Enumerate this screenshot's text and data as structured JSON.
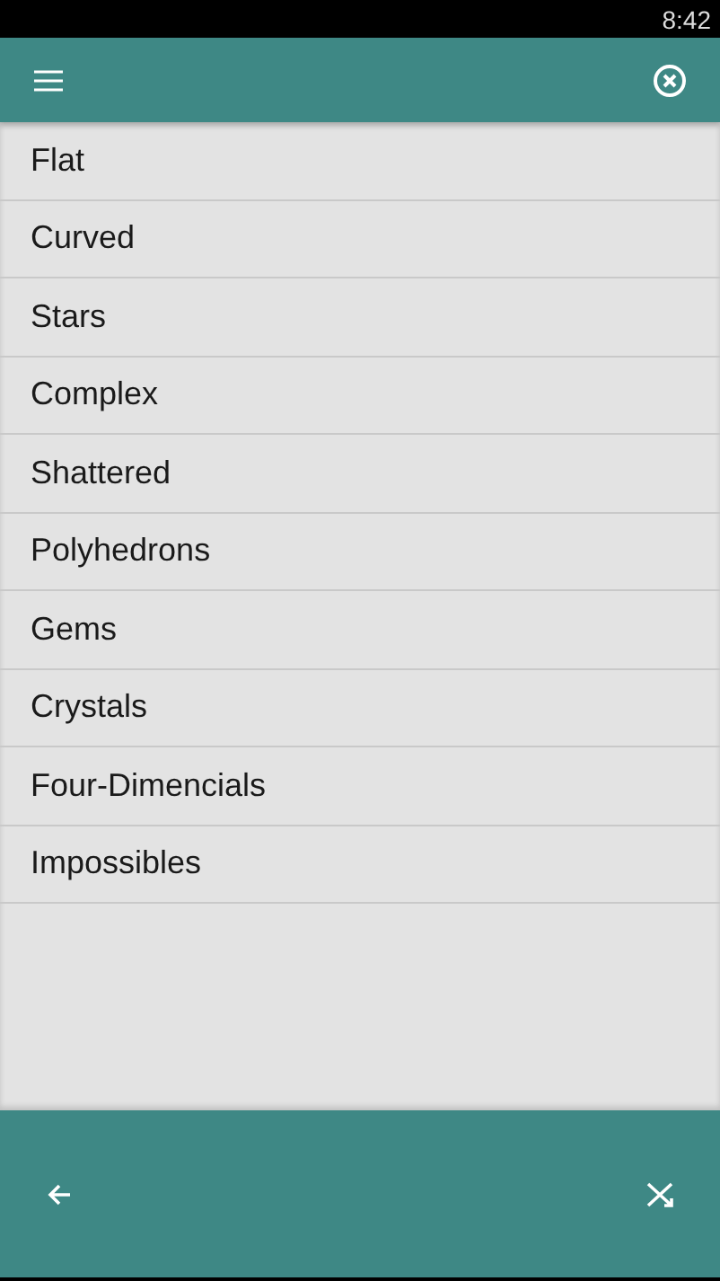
{
  "status_bar": {
    "time": "8:42"
  },
  "list": {
    "items": [
      {
        "label": "Flat"
      },
      {
        "label": "Curved"
      },
      {
        "label": "Stars"
      },
      {
        "label": "Complex"
      },
      {
        "label": "Shattered"
      },
      {
        "label": "Polyhedrons"
      },
      {
        "label": "Gems"
      },
      {
        "label": "Crystals"
      },
      {
        "label": "Four-Dimencials"
      },
      {
        "label": "Impossibles"
      }
    ]
  }
}
